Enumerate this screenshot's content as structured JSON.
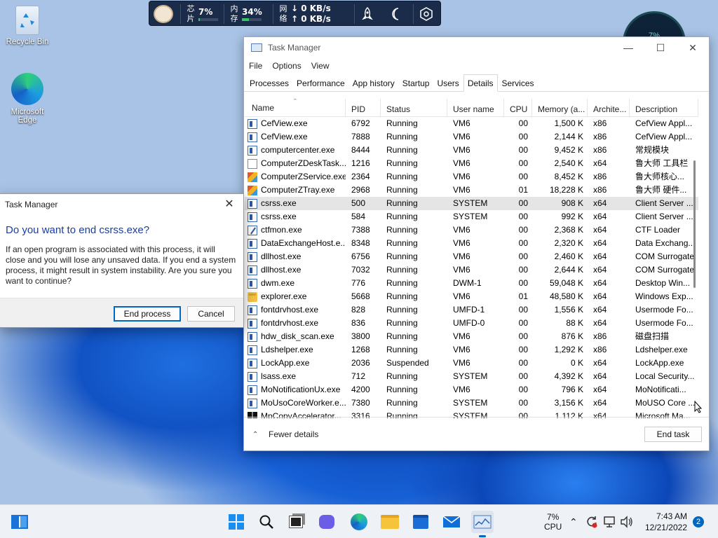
{
  "desktop": {
    "icons": [
      {
        "label": "Recycle Bin"
      },
      {
        "label": "Microsoft Edge"
      }
    ]
  },
  "monitor_widget": {
    "cpu_label": "芯\n片",
    "cpu_label_top": "芯",
    "cpu_label_bottom": "片",
    "cpu_value": "7%",
    "cpu_fraction": 0.07,
    "mem_label_top": "内",
    "mem_label_bottom": "存",
    "mem_value": "34%",
    "mem_fraction": 0.34,
    "net_label_top": "网",
    "net_label_bottom": "络",
    "net_down": "↓ 0 KB/s",
    "net_up": "↑ 0 KB/s"
  },
  "clock_widget": {
    "text": "7%"
  },
  "task_manager": {
    "title": "Task Manager",
    "menu": [
      "File",
      "Options",
      "View"
    ],
    "tabs": [
      "Processes",
      "Performance",
      "App history",
      "Startup",
      "Users",
      "Details",
      "Services"
    ],
    "active_tab": "Details",
    "columns": [
      "Name",
      "PID",
      "Status",
      "User name",
      "CPU",
      "Memory (a...",
      "Archite...",
      "Description"
    ],
    "rows": [
      {
        "icon": "process-icon",
        "name": "CefView.exe",
        "pid": "6792",
        "status": "Running",
        "user": "VM6",
        "cpu": "00",
        "mem": "1,500 K",
        "arch": "x86",
        "desc": "CefView Appl..."
      },
      {
        "icon": "process-icon",
        "name": "CefView.exe",
        "pid": "7888",
        "status": "Running",
        "user": "VM6",
        "cpu": "00",
        "mem": "2,144 K",
        "arch": "x86",
        "desc": "CefView Appl..."
      },
      {
        "icon": "process-icon",
        "name": "computercenter.exe",
        "pid": "8444",
        "status": "Running",
        "user": "VM6",
        "cpu": "00",
        "mem": "9,452 K",
        "arch": "x86",
        "desc": "常规模块"
      },
      {
        "icon": "document-icon",
        "name": "ComputerZDeskTask...",
        "pid": "1216",
        "status": "Running",
        "user": "VM6",
        "cpu": "00",
        "mem": "2,540 K",
        "arch": "x64",
        "desc": "鲁大师 工具栏"
      },
      {
        "icon": "multicolor-icon",
        "name": "ComputerZService.exe",
        "pid": "2364",
        "status": "Running",
        "user": "VM6",
        "cpu": "00",
        "mem": "8,452 K",
        "arch": "x86",
        "desc": "鲁大师核心..."
      },
      {
        "icon": "multicolor-icon",
        "name": "ComputerZTray.exe",
        "pid": "2968",
        "status": "Running",
        "user": "VM6",
        "cpu": "01",
        "mem": "18,228 K",
        "arch": "x86",
        "desc": "鲁大师 硬件..."
      },
      {
        "icon": "process-icon",
        "name": "csrss.exe",
        "pid": "500",
        "status": "Running",
        "user": "SYSTEM",
        "cpu": "00",
        "mem": "908 K",
        "arch": "x64",
        "desc": "Client Server ...",
        "selected": true
      },
      {
        "icon": "process-icon",
        "name": "csrss.exe",
        "pid": "584",
        "status": "Running",
        "user": "SYSTEM",
        "cpu": "00",
        "mem": "992 K",
        "arch": "x64",
        "desc": "Client Server ..."
      },
      {
        "icon": "pen-icon",
        "name": "ctfmon.exe",
        "pid": "7388",
        "status": "Running",
        "user": "VM6",
        "cpu": "00",
        "mem": "2,368 K",
        "arch": "x64",
        "desc": "CTF Loader"
      },
      {
        "icon": "process-icon",
        "name": "DataExchangeHost.e...",
        "pid": "8348",
        "status": "Running",
        "user": "VM6",
        "cpu": "00",
        "mem": "2,320 K",
        "arch": "x64",
        "desc": "Data Exchang..."
      },
      {
        "icon": "process-icon",
        "name": "dllhost.exe",
        "pid": "6756",
        "status": "Running",
        "user": "VM6",
        "cpu": "00",
        "mem": "2,460 K",
        "arch": "x64",
        "desc": "COM Surrogate"
      },
      {
        "icon": "process-icon",
        "name": "dllhost.exe",
        "pid": "7032",
        "status": "Running",
        "user": "VM6",
        "cpu": "00",
        "mem": "2,644 K",
        "arch": "x64",
        "desc": "COM Surrogate"
      },
      {
        "icon": "process-icon",
        "name": "dwm.exe",
        "pid": "776",
        "status": "Running",
        "user": "DWM-1",
        "cpu": "00",
        "mem": "59,048 K",
        "arch": "x64",
        "desc": "Desktop Win..."
      },
      {
        "icon": "folder-icon",
        "name": "explorer.exe",
        "pid": "5668",
        "status": "Running",
        "user": "VM6",
        "cpu": "01",
        "mem": "48,580 K",
        "arch": "x64",
        "desc": "Windows Exp..."
      },
      {
        "icon": "process-icon",
        "name": "fontdrvhost.exe",
        "pid": "828",
        "status": "Running",
        "user": "UMFD-1",
        "cpu": "00",
        "mem": "1,556 K",
        "arch": "x64",
        "desc": "Usermode Fo..."
      },
      {
        "icon": "process-icon",
        "name": "fontdrvhost.exe",
        "pid": "836",
        "status": "Running",
        "user": "UMFD-0",
        "cpu": "00",
        "mem": "88 K",
        "arch": "x64",
        "desc": "Usermode Fo..."
      },
      {
        "icon": "process-icon",
        "name": "hdw_disk_scan.exe",
        "pid": "3800",
        "status": "Running",
        "user": "VM6",
        "cpu": "00",
        "mem": "876 K",
        "arch": "x86",
        "desc": "磁盘扫描"
      },
      {
        "icon": "process-icon",
        "name": "Ldshelper.exe",
        "pid": "1268",
        "status": "Running",
        "user": "VM6",
        "cpu": "00",
        "mem": "1,292 K",
        "arch": "x86",
        "desc": "Ldshelper.exe"
      },
      {
        "icon": "process-icon",
        "name": "LockApp.exe",
        "pid": "2036",
        "status": "Suspended",
        "user": "VM6",
        "cpu": "00",
        "mem": "0 K",
        "arch": "x64",
        "desc": "LockApp.exe"
      },
      {
        "icon": "process-icon",
        "name": "lsass.exe",
        "pid": "712",
        "status": "Running",
        "user": "SYSTEM",
        "cpu": "00",
        "mem": "4,392 K",
        "arch": "x64",
        "desc": "Local Security..."
      },
      {
        "icon": "process-icon",
        "name": "MoNotificationUx.exe",
        "pid": "4200",
        "status": "Running",
        "user": "VM6",
        "cpu": "00",
        "mem": "796 K",
        "arch": "x64",
        "desc": "MoNotificati..."
      },
      {
        "icon": "process-icon",
        "name": "MoUsoCoreWorker.e...",
        "pid": "7380",
        "status": "Running",
        "user": "SYSTEM",
        "cpu": "00",
        "mem": "3,156 K",
        "arch": "x64",
        "desc": "MoUSO Core ..."
      },
      {
        "icon": "windows-icon",
        "name": "MpCopyAccelerator...",
        "pid": "3316",
        "status": "Running",
        "user": "SYSTEM",
        "cpu": "00",
        "mem": "1,112 K",
        "arch": "x64",
        "desc": "Microsoft Ma..."
      }
    ],
    "fewer_details": "Fewer details",
    "end_task": "End task"
  },
  "dialog": {
    "title": "Task Manager",
    "question": "Do you want to end csrss.exe?",
    "body": "If an open program is associated with this process, it will close and you will lose any unsaved data. If you end a system process, it might result in system instability. Are you sure you want to continue?",
    "end_process": "End process",
    "cancel": "Cancel"
  },
  "taskbar": {
    "cpu_value": "7%",
    "cpu_label": "CPU",
    "time": "7:43 AM",
    "date": "12/21/2022",
    "notification_count": "2"
  }
}
